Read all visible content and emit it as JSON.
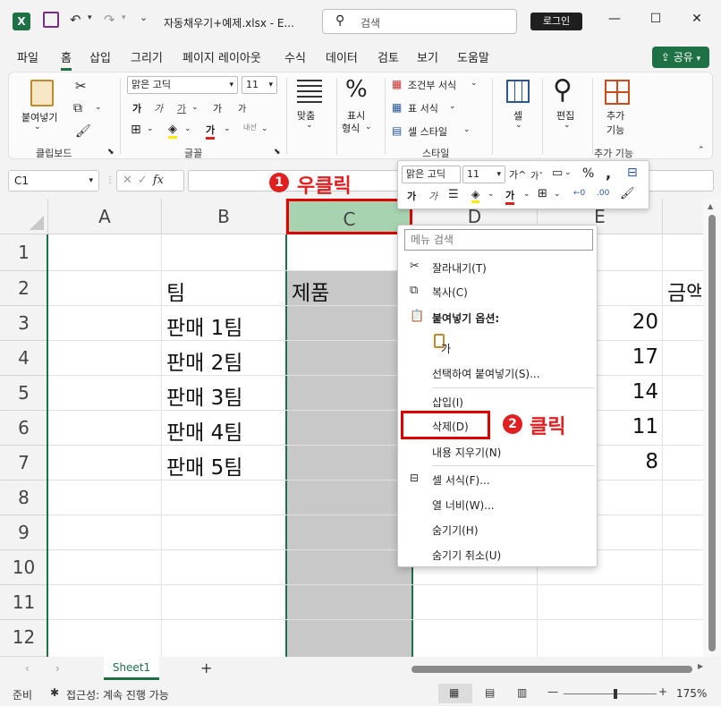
{
  "titlebar": {
    "filename": "자동채우기+예제.xlsx  -  E...",
    "search_placeholder": "검색",
    "login": "로그인"
  },
  "menu": {
    "tabs": [
      "파일",
      "홈",
      "삽입",
      "그리기",
      "페이지 레이아웃",
      "수식",
      "데이터",
      "검토",
      "보기",
      "도움말"
    ],
    "share": "공유"
  },
  "ribbon": {
    "clipboard": {
      "paste": "붙여넣기",
      "label": "클립보드"
    },
    "font": {
      "name": "맑은 고딕",
      "size": "11",
      "label": "글꼴",
      "bold": "가",
      "italic": "가",
      "underline": "가",
      "grow": "가",
      "shrink": "가",
      "color": "가",
      "phonetic": "내선"
    },
    "align": {
      "label": "맞춤"
    },
    "number": {
      "label1": "표시",
      "label2": "형식"
    },
    "styles": {
      "cond": "조건부 서식",
      "table": "표 서식",
      "cell": "셀 스타일",
      "label": "스타일"
    },
    "cells": {
      "label": "셀"
    },
    "editing": {
      "label": "편집"
    },
    "addins": {
      "label1": "추가",
      "label2": "기능",
      "group": "추가 기능"
    }
  },
  "formula": {
    "name_box": "C1",
    "fx": "fx"
  },
  "grid": {
    "columns": [
      "A",
      "B",
      "C",
      "D",
      "E"
    ],
    "rows": [
      "1",
      "2",
      "3",
      "4",
      "5",
      "6",
      "7",
      "8",
      "9",
      "10",
      "11",
      "12"
    ],
    "b_values": [
      "",
      "팀",
      "판매 1팀",
      "판매 2팀",
      "판매 3팀",
      "판매 4팀",
      "판매 5팀"
    ],
    "c2": "제품",
    "e_values": [
      "20",
      "17",
      "14",
      "11",
      "8"
    ],
    "f2": "금액"
  },
  "annotations": {
    "step1_badge": "1",
    "step1_label": "우클릭",
    "step2_badge": "2",
    "step2_label": "클릭"
  },
  "mini_toolbar": {
    "font": "맑은 고딕",
    "size": "11"
  },
  "context_menu": {
    "search_placeholder": "메뉴 검색",
    "cut": "잘라내기(T)",
    "copy": "복사(C)",
    "paste_options": "붙여넣기 옵션:",
    "paste_special": "선택하여 붙여넣기(S)...",
    "insert": "삽입(I)",
    "delete": "삭제(D)",
    "clear": "내용 지우기(N)",
    "format_cells": "셀 서식(F)...",
    "col_width": "열 너비(W)...",
    "hide": "숨기기(H)",
    "unhide": "숨기기 취소(U)"
  },
  "sheet_tabs": {
    "active": "Sheet1",
    "add": "+"
  },
  "status": {
    "ready": "준비",
    "accessibility": "접근성: 계속 진행 가능",
    "zoom": "175%"
  }
}
